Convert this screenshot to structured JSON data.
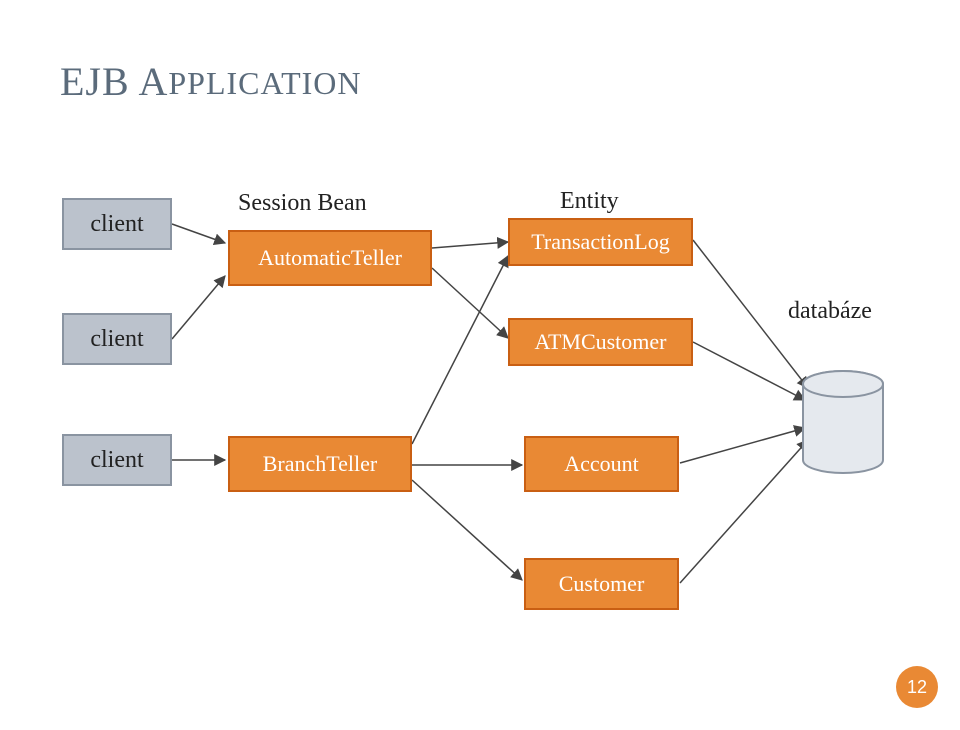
{
  "title": {
    "word1": "EJB",
    "word2_first": "A",
    "word2_rest": "PPLICATION"
  },
  "labels": {
    "sessionBean": "Session Bean",
    "entity": "Entity",
    "database": "databáze"
  },
  "clients": {
    "c1": "client",
    "c2": "client",
    "c3": "client"
  },
  "session": {
    "automaticTeller": "AutomaticTeller",
    "branchTeller": "BranchTeller"
  },
  "entities": {
    "transactionLog": "TransactionLog",
    "atmCustomer": "ATMCustomer",
    "account": "Account",
    "customer": "Customer"
  },
  "pageNumber": "12"
}
